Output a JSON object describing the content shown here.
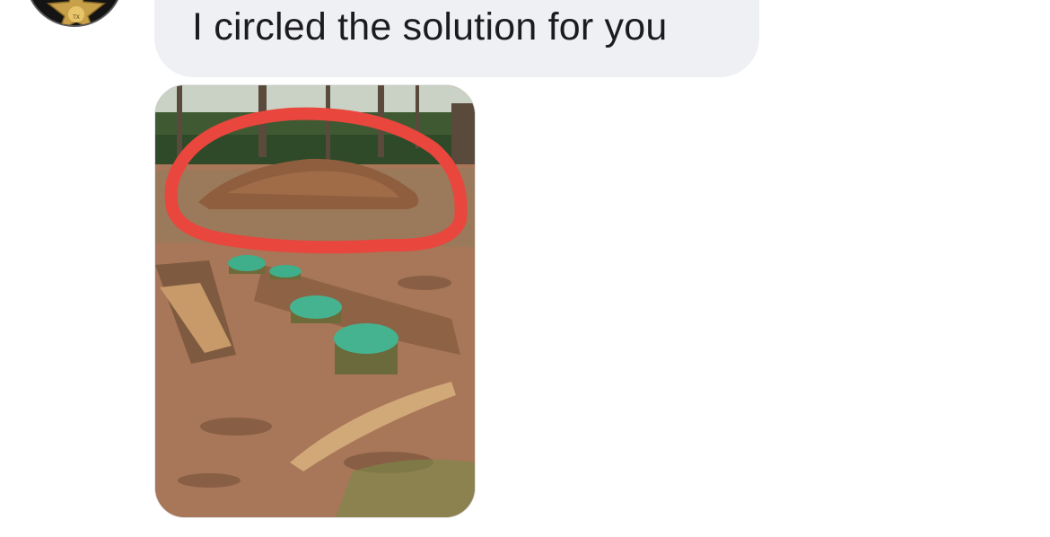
{
  "message": {
    "text": "I circled the solution for you"
  },
  "avatar": {
    "icon": "sheriff-badge-icon",
    "badge_text": "TX"
  },
  "photo": {
    "icon": "image-thumbnail",
    "annotation_color": "#e9463d"
  },
  "colors": {
    "bubble": "#eff0f4",
    "text": "#1c1c1e",
    "background": "#ffffff"
  }
}
